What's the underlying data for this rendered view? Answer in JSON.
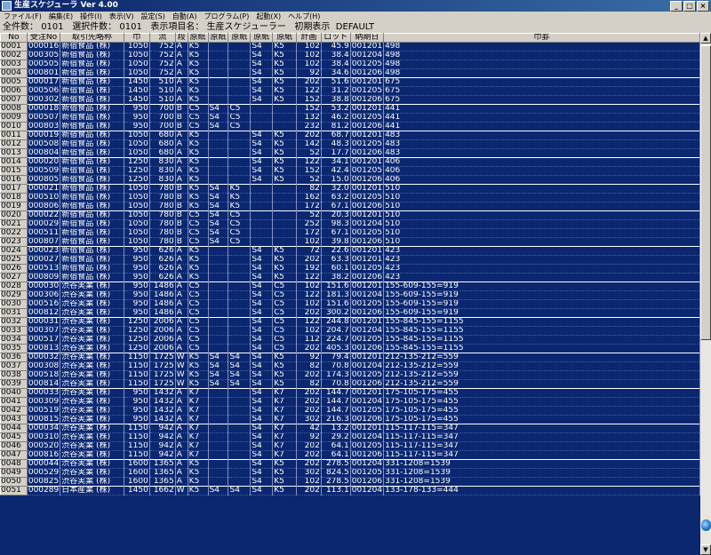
{
  "window": {
    "title": "生産スケジューラ Ver 4.00",
    "min": "_",
    "max": "□",
    "close": "×"
  },
  "menu": [
    "ファイル(F)",
    "編集(E)",
    "操作(I)",
    "表示(V)",
    "設定(S)",
    "自動(A)",
    "プログラム(P)",
    "起動(X)",
    "ヘルプ(H)"
  ],
  "info": {
    "total_label": "全件数：",
    "total": "0101",
    "selected_label": "選択件数：",
    "selected": "0101",
    "display_label": "表示項目名：",
    "display_name": "生産スケジューラー",
    "init_label": "初期表示",
    "default": "DEFAULT"
  },
  "columns": [
    "No",
    "受注No",
    "取引先略称",
    "巾",
    "流",
    "段",
    "原紙",
    "原紙",
    "原紙",
    "原紙",
    "原紙",
    "計画",
    "ロット",
    "納期日",
    "巾罫"
  ],
  "colors": {
    "grid_bg": "#0a2770",
    "text": "#ffffff"
  },
  "rows": [
    [
      "0001",
      "000016",
      "新宿食品 (株)",
      "1050",
      "752",
      "A",
      "K5",
      "",
      "",
      "S4",
      "K5",
      "102",
      "45.9",
      "001201",
      "498"
    ],
    [
      "0002",
      "000305",
      "新宿食品 (株)",
      "1050",
      "752",
      "A",
      "K5",
      "",
      "",
      "S4",
      "K5",
      "102",
      "38.4",
      "001204",
      "498"
    ],
    [
      "0003",
      "000505",
      "新宿食品 (株)",
      "1050",
      "752",
      "A",
      "K5",
      "",
      "",
      "S4",
      "K5",
      "102",
      "38.4",
      "001205",
      "498"
    ],
    [
      "0004",
      "000801",
      "新宿食品 (株)",
      "1050",
      "752",
      "A",
      "K5",
      "",
      "",
      "S4",
      "K5",
      "92",
      "34.6",
      "001206",
      "498"
    ],
    [
      "0005",
      "000017",
      "新宿食品 (株)",
      "1450",
      "510",
      "A",
      "K5",
      "",
      "",
      "S4",
      "K5",
      "202",
      "51.6",
      "001201",
      "675"
    ],
    [
      "0006",
      "000506",
      "新宿食品 (株)",
      "1450",
      "510",
      "A",
      "K5",
      "",
      "",
      "S4",
      "K5",
      "122",
      "31.2",
      "001205",
      "675"
    ],
    [
      "0007",
      "000302",
      "新宿食品 (株)",
      "1450",
      "510",
      "A",
      "K5",
      "",
      "",
      "S4",
      "K5",
      "152",
      "38.8",
      "001206",
      "675"
    ],
    [
      "0008",
      "000018",
      "新宿食品 (株)",
      "950",
      "700",
      "B",
      "C5",
      "S4",
      "C5",
      "",
      "",
      "152",
      "53.2",
      "001201",
      "441"
    ],
    [
      "0009",
      "000507",
      "新宿食品 (株)",
      "950",
      "700",
      "B",
      "C5",
      "S4",
      "C5",
      "",
      "",
      "132",
      "46.2",
      "001205",
      "441"
    ],
    [
      "0010",
      "000803",
      "新宿食品 (株)",
      "950",
      "700",
      "B",
      "C5",
      "S4",
      "C5",
      "",
      "",
      "232",
      "81.2",
      "001206",
      "441"
    ],
    [
      "0011",
      "000019",
      "新宿食品 (株)",
      "1050",
      "680",
      "A",
      "K5",
      "",
      "",
      "S4",
      "K5",
      "202",
      "68.7",
      "001201",
      "483"
    ],
    [
      "0012",
      "000508",
      "新宿食品 (株)",
      "1050",
      "680",
      "A",
      "K5",
      "",
      "",
      "S4",
      "K5",
      "142",
      "48.3",
      "001205",
      "483"
    ],
    [
      "0013",
      "000804",
      "新宿食品 (株)",
      "1050",
      "680",
      "A",
      "K5",
      "",
      "",
      "S4",
      "K5",
      "52",
      "17.7",
      "001206",
      "483"
    ],
    [
      "0014",
      "000020",
      "新宿食品 (株)",
      "1250",
      "830",
      "A",
      "K5",
      "",
      "",
      "S4",
      "K5",
      "122",
      "34.1",
      "001201",
      "406"
    ],
    [
      "0015",
      "000509",
      "新宿食品 (株)",
      "1250",
      "830",
      "A",
      "K5",
      "",
      "",
      "S4",
      "K5",
      "152",
      "42.4",
      "001205",
      "406"
    ],
    [
      "0016",
      "000805",
      "新宿食品 (株)",
      "1250",
      "830",
      "A",
      "K5",
      "",
      "",
      "S4",
      "K5",
      "52",
      "15.0",
      "001206",
      "406"
    ],
    [
      "0017",
      "000021",
      "新宿食品 (株)",
      "1050",
      "780",
      "B",
      "K5",
      "S4",
      "K5",
      "",
      "",
      "82",
      "32.0",
      "001201",
      "510"
    ],
    [
      "0018",
      "000510",
      "新宿食品 (株)",
      "1050",
      "780",
      "B",
      "K5",
      "S4",
      "K5",
      "",
      "",
      "162",
      "63.2",
      "001205",
      "510"
    ],
    [
      "0019",
      "000806",
      "新宿食品 (株)",
      "1050",
      "780",
      "B",
      "K5",
      "S4",
      "K5",
      "",
      "",
      "172",
      "67.1",
      "001206",
      "510"
    ],
    [
      "0020",
      "000022",
      "新宿食品 (株)",
      "1050",
      "780",
      "B",
      "C5",
      "S4",
      "C5",
      "",
      "",
      "52",
      "20.3",
      "001201",
      "510"
    ],
    [
      "0021",
      "000029",
      "新宿食品 (株)",
      "1050",
      "780",
      "B",
      "C5",
      "S4",
      "C5",
      "",
      "",
      "252",
      "98.3",
      "001204",
      "510"
    ],
    [
      "0022",
      "000511",
      "新宿食品 (株)",
      "1050",
      "780",
      "B",
      "C5",
      "S4",
      "C5",
      "",
      "",
      "172",
      "67.1",
      "001205",
      "510"
    ],
    [
      "0023",
      "000807",
      "新宿食品 (株)",
      "1050",
      "780",
      "B",
      "C5",
      "S4",
      "C5",
      "",
      "",
      "102",
      "39.8",
      "001206",
      "510"
    ],
    [
      "0024",
      "000023",
      "新宿食品 (株)",
      "950",
      "626",
      "A",
      "K5",
      "",
      "",
      "S4",
      "K5",
      "72",
      "22.6",
      "001201",
      "423"
    ],
    [
      "0025",
      "000027",
      "新宿食品 (株)",
      "950",
      "626",
      "A",
      "K5",
      "",
      "",
      "S4",
      "K5",
      "202",
      "63.3",
      "001201",
      "423"
    ],
    [
      "0026",
      "000513",
      "新宿食品 (株)",
      "950",
      "626",
      "A",
      "K5",
      "",
      "",
      "S4",
      "K5",
      "192",
      "60.1",
      "001205",
      "423"
    ],
    [
      "0027",
      "000809",
      "新宿食品 (株)",
      "950",
      "626",
      "A",
      "K5",
      "",
      "",
      "S4",
      "K5",
      "122",
      "38.2",
      "001206",
      "423"
    ],
    [
      "0028",
      "000030",
      "渋谷実業 (株)",
      "950",
      "1486",
      "A",
      "C5",
      "",
      "",
      "S4",
      "C5",
      "102",
      "151.6",
      "001201",
      "155-609-155=919"
    ],
    [
      "0029",
      "000306",
      "渋谷実業 (株)",
      "950",
      "1486",
      "A",
      "C5",
      "",
      "",
      "S4",
      "C5",
      "122",
      "181.3",
      "001204",
      "155-609-155=919"
    ],
    [
      "0030",
      "000516",
      "渋谷実業 (株)",
      "950",
      "1486",
      "A",
      "C5",
      "",
      "",
      "S4",
      "C5",
      "102",
      "151.6",
      "001205",
      "155-609-155=919"
    ],
    [
      "0031",
      "000812",
      "渋谷実業 (株)",
      "950",
      "1486",
      "A",
      "C5",
      "",
      "",
      "S4",
      "C5",
      "202",
      "300.2",
      "001206",
      "155-609-155=919"
    ],
    [
      "0032",
      "000031",
      "渋谷実業 (株)",
      "1250",
      "2006",
      "A",
      "C5",
      "",
      "",
      "S4",
      "C5",
      "122",
      "244.8",
      "001201",
      "155-845-155=1155"
    ],
    [
      "0033",
      "000307",
      "渋谷実業 (株)",
      "1250",
      "2006",
      "A",
      "C5",
      "",
      "",
      "S4",
      "C5",
      "102",
      "204.7",
      "001204",
      "155-845-155=1155"
    ],
    [
      "0034",
      "000517",
      "渋谷実業 (株)",
      "1250",
      "2006",
      "A",
      "C5",
      "",
      "",
      "S4",
      "C5",
      "112",
      "224.7",
      "001205",
      "155-845-155=1155"
    ],
    [
      "0035",
      "000813",
      "渋谷実業 (株)",
      "1250",
      "2006",
      "A",
      "C5",
      "",
      "",
      "S4",
      "C5",
      "202",
      "405.3",
      "001206",
      "155-845-155=1155"
    ],
    [
      "0036",
      "000032",
      "渋谷実業 (株)",
      "1150",
      "1725",
      "W",
      "K5",
      "S4",
      "S4",
      "S4",
      "K5",
      "92",
      "79.4",
      "001201",
      "212-135-212=559"
    ],
    [
      "0037",
      "000308",
      "渋谷実業 (株)",
      "1150",
      "1725",
      "W",
      "K5",
      "S4",
      "S4",
      "S4",
      "K5",
      "82",
      "70.8",
      "001204",
      "212-135-212=559"
    ],
    [
      "0038",
      "000518",
      "渋谷実業 (株)",
      "1150",
      "1725",
      "W",
      "K5",
      "S4",
      "S4",
      "S4",
      "K5",
      "202",
      "174.3",
      "001205",
      "212-135-212=559"
    ],
    [
      "0039",
      "000814",
      "渋谷実業 (株)",
      "1150",
      "1725",
      "W",
      "K5",
      "S4",
      "S4",
      "S4",
      "K5",
      "82",
      "70.8",
      "001206",
      "212-135-212=559"
    ],
    [
      "0040",
      "000033",
      "渋谷実業 (株)",
      "950",
      "1432",
      "A",
      "K7",
      "",
      "",
      "S4",
      "K7",
      "202",
      "144.7",
      "001201",
      "175-105-175=455"
    ],
    [
      "0041",
      "000309",
      "渋谷実業 (株)",
      "950",
      "1432",
      "A",
      "K7",
      "",
      "",
      "S4",
      "K7",
      "202",
      "144.7",
      "001204",
      "175-105-175=455"
    ],
    [
      "0042",
      "000519",
      "渋谷実業 (株)",
      "950",
      "1432",
      "A",
      "K7",
      "",
      "",
      "S4",
      "K7",
      "202",
      "144.7",
      "001205",
      "175-105-175=455"
    ],
    [
      "0043",
      "000815",
      "渋谷実業 (株)",
      "950",
      "1432",
      "A",
      "K7",
      "",
      "",
      "S4",
      "K7",
      "302",
      "216.3",
      "001206",
      "175-105-175=455"
    ],
    [
      "0044",
      "000034",
      "渋谷実業 (株)",
      "1150",
      "942",
      "A",
      "K7",
      "",
      "",
      "S4",
      "K7",
      "42",
      "13.2",
      "001201",
      "115-117-115=347"
    ],
    [
      "0045",
      "000310",
      "渋谷実業 (株)",
      "1150",
      "942",
      "A",
      "K7",
      "",
      "",
      "S4",
      "K7",
      "92",
      "29.2",
      "001204",
      "115-117-115=347"
    ],
    [
      "0046",
      "000520",
      "渋谷実業 (株)",
      "1150",
      "942",
      "A",
      "K7",
      "",
      "",
      "S4",
      "K7",
      "202",
      "64.1",
      "001205",
      "115-117-115=347"
    ],
    [
      "0047",
      "000816",
      "渋谷実業 (株)",
      "1150",
      "942",
      "A",
      "K7",
      "",
      "",
      "S4",
      "K7",
      "202",
      "64.1",
      "001206",
      "115-117-115=347"
    ],
    [
      "0048",
      "000044",
      "渋谷実業 (株)",
      "1600",
      "1365",
      "A",
      "K5",
      "",
      "",
      "S4",
      "K5",
      "202",
      "278.5",
      "001204",
      "331-1208=1539"
    ],
    [
      "0049",
      "000529",
      "渋谷実業 (株)",
      "1600",
      "1365",
      "A",
      "K5",
      "",
      "",
      "S4",
      "K5",
      "302",
      "824.5",
      "001205",
      "331-1208=1539"
    ],
    [
      "0050",
      "000825",
      "渋谷実業 (株)",
      "1600",
      "1365",
      "A",
      "K5",
      "",
      "",
      "S4",
      "K5",
      "102",
      "278.5",
      "001206",
      "331-1208=1539"
    ],
    [
      "0051",
      "000289",
      "日本産業 (株)",
      "1450",
      "1662",
      "W",
      "K5",
      "S4",
      "S4",
      "S4",
      "K5",
      "202",
      "113.1",
      "001204",
      "133-178-133=444"
    ]
  ]
}
